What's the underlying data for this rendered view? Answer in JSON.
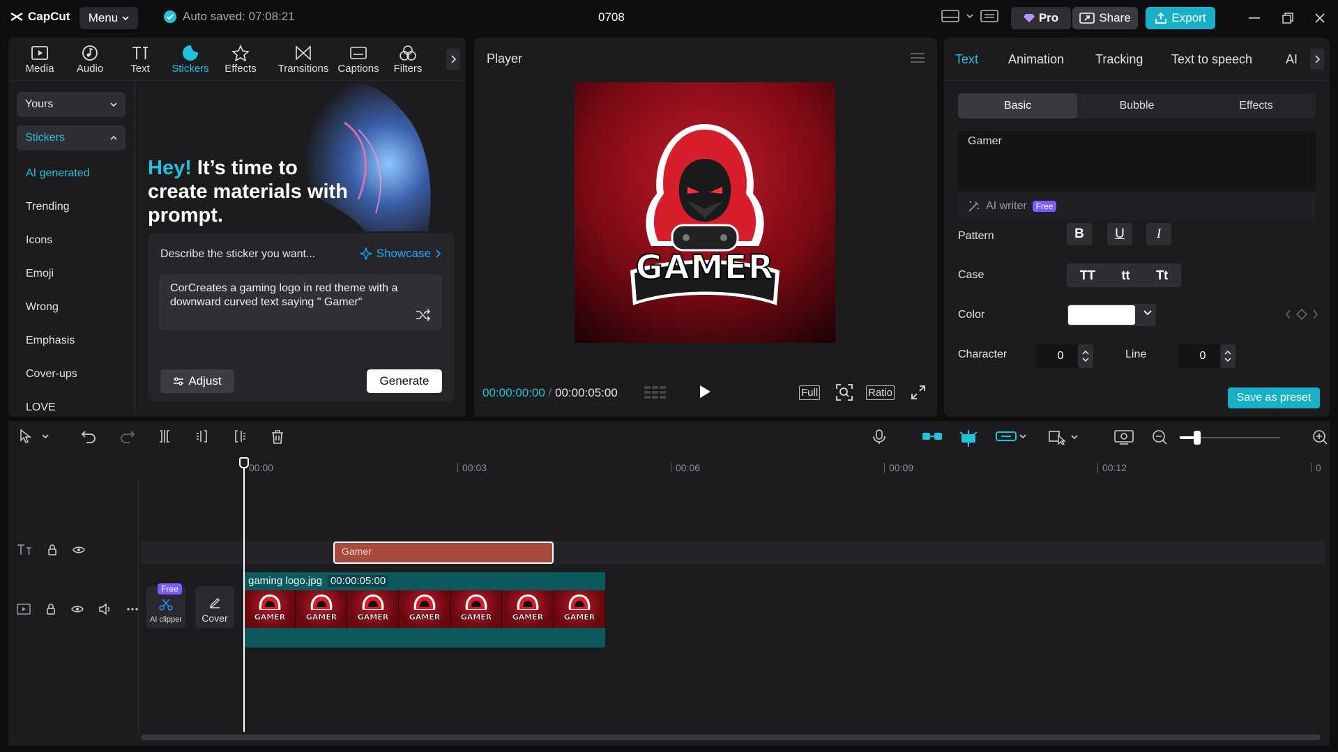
{
  "app": {
    "name": "CapCut",
    "menu_label": "Menu",
    "autosave": "Auto saved: 07:08:21",
    "project_title": "0708",
    "pro_label": "Pro",
    "share_label": "Share",
    "export_label": "Export"
  },
  "toolbar": {
    "items": [
      {
        "label": "Media",
        "icon": "media-icon"
      },
      {
        "label": "Audio",
        "icon": "audio-icon"
      },
      {
        "label": "Text",
        "icon": "text-icon"
      },
      {
        "label": "Stickers",
        "icon": "stickers-icon",
        "active": true
      },
      {
        "label": "Effects",
        "icon": "effects-icon"
      },
      {
        "label": "Transitions",
        "icon": "transitions-icon"
      },
      {
        "label": "Captions",
        "icon": "captions-icon"
      },
      {
        "label": "Filters",
        "icon": "filters-icon"
      }
    ]
  },
  "sidebar": {
    "yours": "Yours",
    "stickers": "Stickers",
    "items": [
      "AI generated",
      "Trending",
      "Icons",
      "Emoji",
      "Wrong",
      "Emphasis",
      "Cover-ups",
      "LOVE"
    ]
  },
  "hero": {
    "hey": "Hey!",
    "rest": " It’s time to create materials with prompt."
  },
  "prompt": {
    "label": "Describe the sticker you want...",
    "showcase": "Showcase",
    "text": "CorCreates a gaming logo in red theme with a downward curved text saying \" Gamer\"",
    "adjust": "Adjust",
    "generate": "Generate"
  },
  "player": {
    "title": "Player",
    "logo_text": "GAMER",
    "current_time": "00:00:00:00",
    "duration": "00:00:05:00",
    "full": "Full",
    "ratio": "Ratio"
  },
  "right": {
    "tabs": [
      "Text",
      "Animation",
      "Tracking",
      "Text to speech",
      "AI"
    ],
    "segments": [
      "Basic",
      "Bubble",
      "Effects"
    ],
    "text_value": "Gamer",
    "ai_writer": "AI writer",
    "free": "Free",
    "pattern_label": "Pattern",
    "pattern_buttons": [
      "B",
      "U",
      "I"
    ],
    "case_label": "Case",
    "case_buttons": [
      "TT",
      "tt",
      "Tt"
    ],
    "color_label": "Color",
    "color_value": "#ffffff",
    "character_label": "Character",
    "character_value": "0",
    "line_label": "Line",
    "line_value": "0",
    "save_preset": "Save as preset"
  },
  "timeline": {
    "ruler": [
      "00:00",
      "00:03",
      "00:06",
      "00:09",
      "00:12",
      "0"
    ],
    "text_clip": "Gamer",
    "video_clip_name": "gaming logo.jpg",
    "video_clip_duration": "00:00:05:00",
    "frame_text": "GAMER",
    "ai_clipper": "AI clipper",
    "free": "Free",
    "cover": "Cover"
  },
  "colors": {
    "accent": "#20c3db",
    "export": "#17b0c6",
    "text_clip": "#a84a3c",
    "video_clip": "#0c5a5e"
  }
}
